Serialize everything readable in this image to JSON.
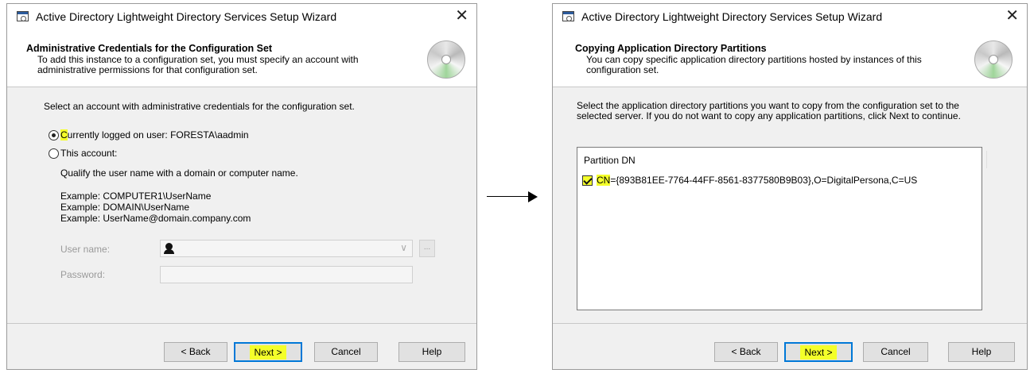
{
  "left_window": {
    "title": "Active Directory Lightweight Directory Services Setup Wizard",
    "close_glyph": "✕",
    "header_title": "Administrative Credentials for the Configuration Set",
    "header_desc": "To add this instance to a configuration set, you must specify an account with administrative permissions for that configuration set.",
    "instruction": "Select an account with administrative credentials for the configuration set.",
    "radio_current_first_letter": "C",
    "radio_current_rest": "urrently logged on user: FORESTA\\aadmin",
    "radio_current_selected": true,
    "radio_this_account": "This account:",
    "qualify_text": "Qualify the user name with a domain or computer name.",
    "examples": [
      "Example: COMPUTER1\\UserName",
      "Example: DOMAIN\\UserName",
      "Example: UserName@domain.company.com"
    ],
    "username_label": "User name:",
    "username_value": "",
    "password_label": "Password:",
    "password_value": "",
    "browse_glyph": "...",
    "dropdown_glyph": "∨",
    "buttons": {
      "back": "< Back",
      "next": "Next >",
      "cancel": "Cancel",
      "help": "Help"
    }
  },
  "right_window": {
    "title": "Active Directory Lightweight Directory Services Setup Wizard",
    "close_glyph": "✕",
    "header_title": "Copying Application Directory Partitions",
    "header_desc": "You can copy specific application directory partitions hosted by instances of this configuration set.",
    "instruction_line1": "Select the application directory partitions you want to copy from the configuration set to the",
    "instruction_line2": "selected server. If you do not want to copy any application partitions, click Next to continue.",
    "list_header": "Partition DN",
    "partitions": [
      {
        "prefix": "CN",
        "rest": "={893B81EE-7764-44FF-8561-8377580B9B03},O=DigitalPersona,C=US",
        "checked": true
      }
    ],
    "buttons": {
      "back": "< Back",
      "next": "Next >",
      "cancel": "Cancel",
      "help": "Help"
    }
  },
  "colors": {
    "highlight": "#f4ff2a",
    "focus_border": "#0078d7",
    "dialog_bg": "#f0f0f0"
  },
  "icons": [
    "wizard-app-icon",
    "cd-disc-icon",
    "user-icon",
    "close-icon",
    "arrow-right-icon"
  ]
}
